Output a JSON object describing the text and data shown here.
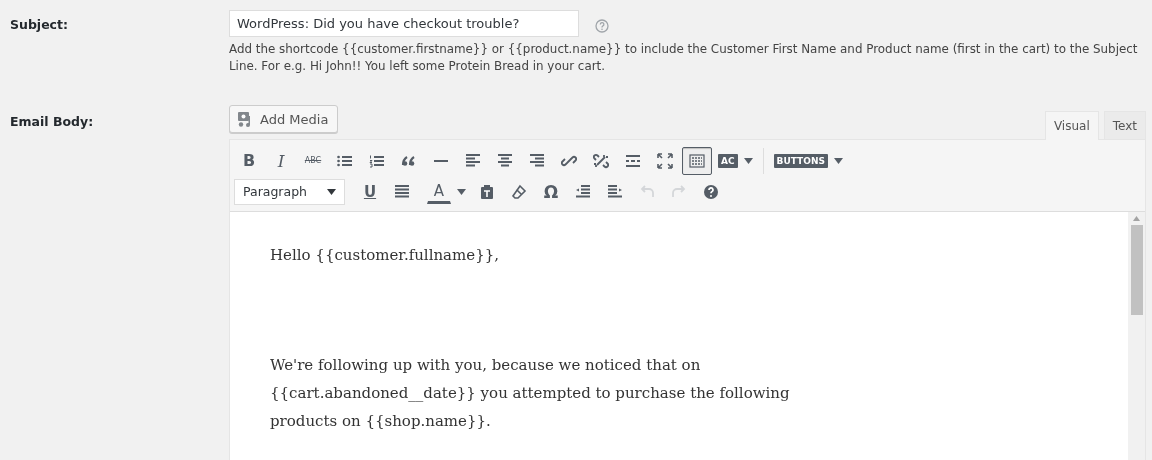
{
  "subject": {
    "label": "Subject:",
    "value": "WordPress: Did you have checkout trouble?",
    "description": "Add the shortcode {{customer.firstname}} or {{product.name}} to include the Customer First Name and Product name (first in the cart) to the Subject Line. For e.g. Hi John!! You left some Protein Bread in your cart."
  },
  "email_body": {
    "label": "Email Body:",
    "add_media": "Add Media",
    "tabs": [
      {
        "label": "Visual",
        "selected": true
      },
      {
        "label": "Text",
        "selected": false
      }
    ],
    "toolbar_row_1": [
      {
        "kind": "bold",
        "label": "B",
        "pressed": false
      },
      {
        "kind": "italic",
        "label": "I",
        "pressed": false
      },
      {
        "kind": "strikethrough",
        "label": "ABC",
        "pressed": false
      },
      {
        "kind": "bullet-list",
        "pressed": false
      },
      {
        "kind": "numbered-list",
        "pressed": false
      },
      {
        "kind": "blockquote",
        "pressed": false
      },
      {
        "kind": "horizontal-rule",
        "pressed": false
      },
      {
        "kind": "align-left",
        "pressed": false
      },
      {
        "kind": "align-center",
        "pressed": false
      },
      {
        "kind": "align-right",
        "pressed": false
      },
      {
        "kind": "link",
        "pressed": false
      },
      {
        "kind": "unlink",
        "pressed": false
      },
      {
        "kind": "read-more",
        "pressed": false
      },
      {
        "kind": "fullscreen",
        "pressed": false
      },
      {
        "kind": "toolbar-toggle",
        "pressed": true
      },
      {
        "kind": "tag-menu",
        "label": "AC",
        "pressed": false
      },
      {
        "kind": "separator",
        "pressed": false
      },
      {
        "kind": "tag-menu",
        "label": "BUTTONS",
        "pressed": false
      }
    ],
    "toolbar_row_2": [
      {
        "kind": "format-select",
        "label": "Paragraph",
        "disabled": false
      },
      {
        "kind": "underline",
        "label": "U",
        "disabled": false
      },
      {
        "kind": "justify",
        "disabled": false
      },
      {
        "kind": "text-color",
        "label": "A",
        "disabled": false
      },
      {
        "kind": "paste-text",
        "disabled": false
      },
      {
        "kind": "clear-formatting",
        "disabled": false
      },
      {
        "kind": "special-character",
        "label": "Ω",
        "disabled": false
      },
      {
        "kind": "outdent",
        "disabled": false
      },
      {
        "kind": "indent",
        "disabled": false
      },
      {
        "kind": "undo",
        "disabled": true
      },
      {
        "kind": "redo",
        "disabled": true
      },
      {
        "kind": "help",
        "disabled": false
      }
    ],
    "paragraphs": [
      "Hello {{customer.fullname}},",
      "We're following up with you, because we noticed that on {{cart.abandoned__date}} you attempted to purchase the following products on {{shop.name}}."
    ]
  }
}
